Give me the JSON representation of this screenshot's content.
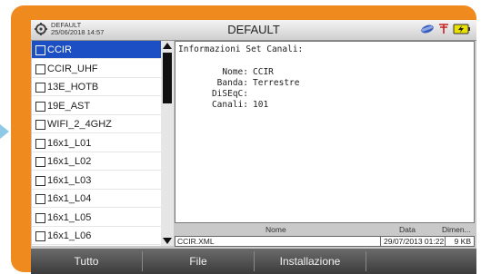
{
  "header": {
    "profile_name": "DEFAULT",
    "datetime": "25/06/2018 14:57",
    "title": "DEFAULT",
    "icons": [
      "settings-cog-icon",
      "lnb-icon",
      "antenna-icon",
      "battery-charging-icon"
    ]
  },
  "channel_sets": [
    {
      "label": "CCIR",
      "selected": true,
      "checked": false
    },
    {
      "label": "CCIR_UHF",
      "selected": false,
      "checked": false
    },
    {
      "label": "13E_HOTB",
      "selected": false,
      "checked": false
    },
    {
      "label": "19E_AST",
      "selected": false,
      "checked": false
    },
    {
      "label": "WIFI_2_4GHZ",
      "selected": false,
      "checked": false
    },
    {
      "label": "16x1_L01",
      "selected": false,
      "checked": false
    },
    {
      "label": "16x1_L02",
      "selected": false,
      "checked": false
    },
    {
      "label": "16x1_L03",
      "selected": false,
      "checked": false
    },
    {
      "label": "16x1_L04",
      "selected": false,
      "checked": false
    },
    {
      "label": "16x1_L05",
      "selected": false,
      "checked": false
    },
    {
      "label": "16x1_L06",
      "selected": false,
      "checked": false
    }
  ],
  "info": {
    "title": "Informazioni Set Canali:",
    "fields": [
      {
        "key": "Nome:",
        "value": "CCIR"
      },
      {
        "key": "Banda:",
        "value": "Terrestre"
      },
      {
        "key": "DiSEqC:",
        "value": ""
      },
      {
        "key": "Canali:",
        "value": "101"
      }
    ]
  },
  "file_table": {
    "headers": {
      "name": "Nome",
      "date": "Data",
      "size": "Dimen..."
    },
    "row": {
      "name": "CCIR.XML",
      "date": "29/07/2013 01:22",
      "size": "9 KB"
    }
  },
  "footer": {
    "buttons": [
      "Tutto",
      "File",
      "Installazione",
      ""
    ]
  },
  "colors": {
    "device_frame": "#ef8a1f",
    "selection": "#1d4fc4",
    "footer": "#4a4a4a"
  }
}
